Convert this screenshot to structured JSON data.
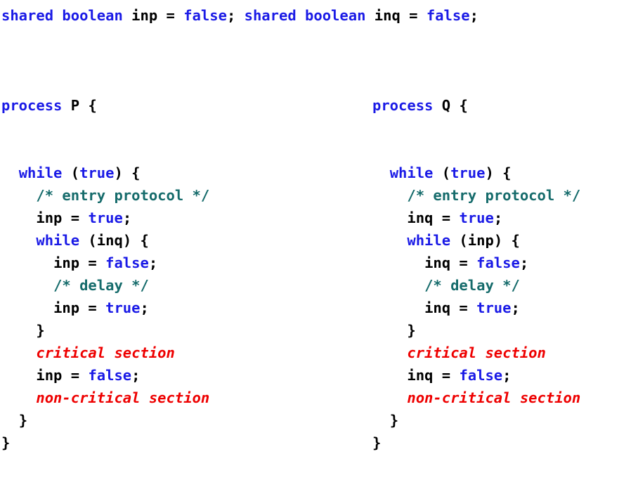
{
  "document": {
    "kind": "source-code-listing",
    "language": "pseudocode",
    "background_color": "#ffffff"
  },
  "palette": {
    "keyword": "#1a1ae6",
    "identifier": "#000000",
    "punctuation": "#000000",
    "comment": "#156b6b",
    "pseudocode": "#ee0000"
  },
  "declaration": {
    "kw_shared_1": "shared",
    "kw_boolean_1": "boolean",
    "var_1": "inp",
    "eq_1": " = ",
    "val_1": "false",
    "semi_1": "; ",
    "kw_shared_2": "shared",
    "kw_boolean_2": "boolean",
    "var_2": "inq",
    "eq_2": " = ",
    "val_2": "false",
    "semi_2": ";"
  },
  "process_p": {
    "header": {
      "keyword": "process",
      "name": "P",
      "brace": "{"
    },
    "lines": [
      {
        "indent": "  ",
        "kw": "while",
        "mid": " (",
        "kw2": "true",
        "tail": ") {"
      },
      {
        "indent": "    ",
        "comment": "/* entry protocol */"
      },
      {
        "indent": "    ",
        "id": "inp",
        "op": " = ",
        "kw": "true",
        "tail": ";"
      },
      {
        "indent": "    ",
        "kw": "while",
        "mid": " (",
        "id": "inq",
        "tail": ") {"
      },
      {
        "indent": "      ",
        "id": "inp",
        "op": " = ",
        "kw": "false",
        "tail": ";"
      },
      {
        "indent": "      ",
        "comment": "/* delay */"
      },
      {
        "indent": "      ",
        "id": "inp",
        "op": " = ",
        "kw": "true",
        "tail": ";"
      },
      {
        "indent": "    ",
        "punc": "}"
      },
      {
        "indent": "    ",
        "pseudo": "critical section"
      },
      {
        "indent": "    ",
        "id": "inp",
        "op": " = ",
        "kw": "false",
        "tail": ";"
      },
      {
        "indent": "    ",
        "pseudo": "non-critical section"
      },
      {
        "indent": "  ",
        "punc": "}"
      },
      {
        "indent": "",
        "punc": "}"
      }
    ]
  },
  "process_q": {
    "header": {
      "keyword": "process",
      "name": "Q",
      "brace": "{"
    },
    "lines": [
      {
        "indent": "  ",
        "kw": "while",
        "mid": " (",
        "kw2": "true",
        "tail": ") {"
      },
      {
        "indent": "    ",
        "comment": "/* entry protocol */"
      },
      {
        "indent": "    ",
        "id": "inq",
        "op": " = ",
        "kw": "true",
        "tail": ";"
      },
      {
        "indent": "    ",
        "kw": "while",
        "mid": " (",
        "id": "inp",
        "tail": ") {"
      },
      {
        "indent": "      ",
        "id": "inq",
        "op": " = ",
        "kw": "false",
        "tail": ";"
      },
      {
        "indent": "      ",
        "comment": "/* delay */"
      },
      {
        "indent": "      ",
        "id": "inq",
        "op": " = ",
        "kw": "true",
        "tail": ";"
      },
      {
        "indent": "    ",
        "punc": "}"
      },
      {
        "indent": "    ",
        "pseudo": "critical section"
      },
      {
        "indent": "    ",
        "id": "inq",
        "op": " = ",
        "kw": "false",
        "tail": ";"
      },
      {
        "indent": "    ",
        "pseudo": "non-critical section"
      },
      {
        "indent": "  ",
        "punc": "}"
      },
      {
        "indent": "",
        "punc": "}"
      }
    ]
  }
}
